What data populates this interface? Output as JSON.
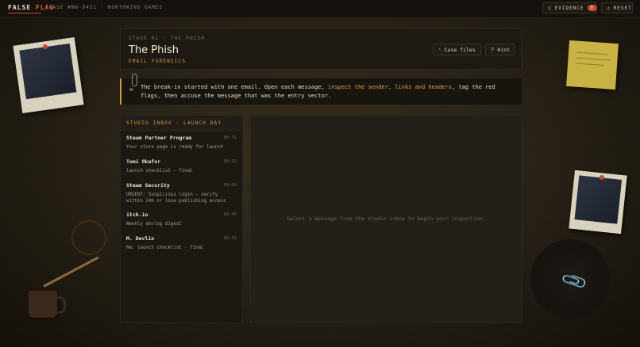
{
  "topbar": {
    "brand_part1": "FALSE",
    "brand_part2": "FLAG",
    "case_label": "CASE #NW-0451 · NORTHWIND GAMES",
    "evidence_label": "EVIDENCE",
    "evidence_count": "0",
    "reset_label": "RESET"
  },
  "stage": {
    "label": "STAGE 01 · THE PHISH",
    "title": "The Phish",
    "subtitle": "EMAIL FORENSICS",
    "case_files_label": "Case files",
    "hint_label": "Hint"
  },
  "intro": {
    "text_before": "The break-in started with one email. Open each message, ",
    "highlight": "inspect the sender, links and headers",
    "text_after": ", tag the red flags, then accuse the message that was the entry vector."
  },
  "inbox": {
    "title": "STUDIO INBOX · LAUNCH DAY",
    "messages": [
      {
        "from": "Steam Partner Program",
        "time": "08:31",
        "subject": "Your store page is ready for launch"
      },
      {
        "from": "Tomi Okafor",
        "time": "08:52",
        "subject": "launch checklist - final"
      },
      {
        "from": "Steam Security",
        "time": "09:09",
        "subject": "URGENT: Suspicious login - verify within 24h or lose publishing access"
      },
      {
        "from": "itch.io",
        "time": "09:40",
        "subject": "Weekly devlog digest"
      },
      {
        "from": "M. Devlin",
        "time": "09:51",
        "subject": "Re: launch checklist - final"
      }
    ]
  },
  "pane": {
    "empty_text": "Select a message from the studio inbox to begin your inspection."
  },
  "colors": {
    "accent": "#d89a3c",
    "brand_red": "#c44a35"
  }
}
